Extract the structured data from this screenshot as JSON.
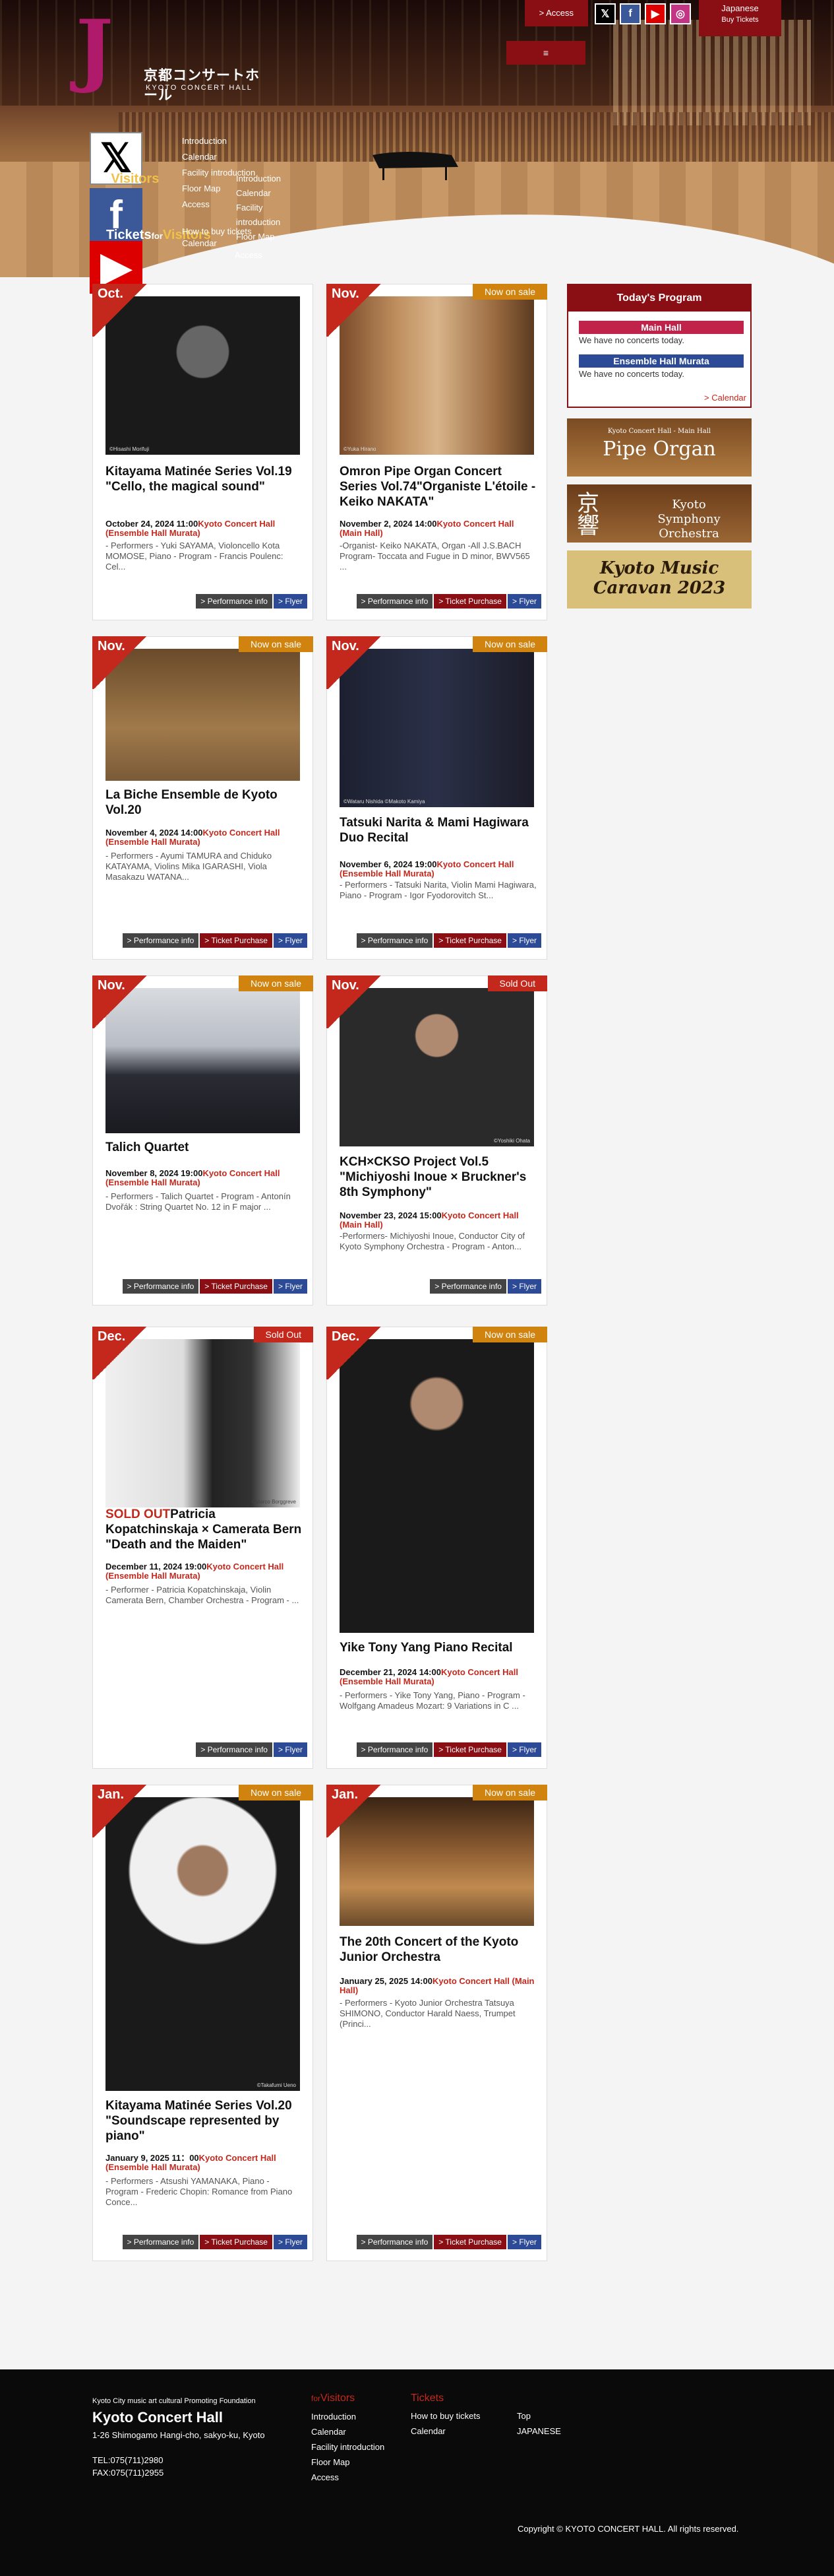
{
  "header": {
    "logo_jp": "京都コンサートホール",
    "logo_en": "KYOTO CONCERT HALL",
    "logo_mark": "J",
    "access_label": "> Access",
    "menu_label": "≡",
    "lang_label": "Japanese",
    "buy_tickets_label": "Buy Tickets",
    "sns": [
      "x-icon",
      "facebook-icon",
      "youtube-icon",
      "instagram-icon"
    ]
  },
  "nav": {
    "visitors_label": "Visitors",
    "for_label": "for",
    "tickets_label": "Tickets",
    "for_visitors_label": "Visitors",
    "links_col1": [
      "Introduction",
      "Calendar",
      "Facility introduction",
      "Floor Map",
      "Access"
    ],
    "links_col2": [
      "Introduction",
      "Calendar",
      "Facility introduction",
      "Floor Map"
    ],
    "tickets_links": [
      "How to buy tickets",
      "Calendar",
      "Access"
    ]
  },
  "cards": [
    {
      "month": "Oct.",
      "status": "",
      "credit": "©Hisashi Morifuji",
      "title": "Kitayama Matinée Series Vol.19 \"Cello, the magical sound\"",
      "date": "October 24, 2024 11:00",
      "venue": "Kyoto Concert Hall (Ensemble Hall Murata)",
      "desc": "- Performers - Yuki SAYAMA, Violoncello Kota MOMOSE, Piano - Program - Francis Poulenc: Cel...",
      "buttons": [
        "> Performance info",
        "> Flyer"
      ]
    },
    {
      "month": "Nov.",
      "status": "Now on sale",
      "credit": "©Yuka Hirano",
      "title": "Omron Pipe Organ Concert Series Vol.74\"Organiste L'étoile - Keiko NAKATA\"",
      "date": "November 2, 2024 14:00",
      "venue": "Kyoto Concert Hall (Main Hall)",
      "desc": "-Organist- Keiko NAKATA, Organ -All J.S.BACH Program- Toccata and Fugue in D minor, BWV565 ...",
      "buttons": [
        "> Performance info",
        "> Ticket Purchase",
        "> Flyer"
      ]
    },
    {
      "month": "Nov.",
      "status": "Now on sale",
      "credit": "",
      "title": "La Biche Ensemble de Kyoto Vol.20",
      "date": "November 4, 2024 14:00",
      "venue": "Kyoto Concert Hall (Ensemble Hall Murata)",
      "desc": "- Performers - Ayumi TAMURA and Chiduko KATAYAMA, Violins Mika IGARASHI, Viola Masakazu WATANA...",
      "buttons": [
        "> Performance info",
        "> Ticket Purchase",
        "> Flyer"
      ]
    },
    {
      "month": "Nov.",
      "status": "Now on sale",
      "credit": "©Wataru Nishida    ©Makoto Kamiya",
      "title": "Tatsuki Narita & Mami Hagiwara Duo Recital",
      "date": "November 6, 2024 19:00",
      "venue": "Kyoto Concert Hall (Ensemble Hall Murata)",
      "desc": "- Performers - Tatsuki Narita, Violin Mami Hagiwara, Piano - Program - Igor Fyodorovitch St...",
      "buttons": [
        "> Performance info",
        "> Ticket Purchase",
        "> Flyer"
      ]
    },
    {
      "month": "Nov.",
      "status": "Now on sale",
      "credit": "",
      "title": "Talich Quartet",
      "date": "November 8, 2024 19:00",
      "venue": "Kyoto Concert Hall (Ensemble Hall Murata)",
      "desc": "- Performers - Talich Quartet - Program - Antonín Dvořák : String Quartet No. 12 in F major ...",
      "buttons": [
        "> Performance info",
        "> Ticket Purchase",
        "> Flyer"
      ]
    },
    {
      "month": "Nov.",
      "status": "Sold Out",
      "credit": "©Yoshiki Ohata",
      "title": "KCH×CKSO Project Vol.5 \"Michiyoshi Inoue × Bruckner's 8th Symphony\"",
      "date": "November 23, 2024 15:00",
      "venue": "Kyoto Concert Hall (Main Hall)",
      "desc": "-Performers- Michiyoshi Inoue, Conductor City of Kyoto Symphony Orchestra - Program - Anton...",
      "buttons": [
        "> Performance info",
        "> Flyer"
      ]
    },
    {
      "month": "Dec.",
      "status": "Sold Out",
      "credit": "©Marco Borggreve",
      "title_prefix": "SOLD OUT",
      "title": "Patricia Kopatchinskaja × Camerata Bern \"Death and the Maiden\"",
      "date": "December 11, 2024 19:00",
      "venue": "Kyoto Concert Hall (Ensemble Hall Murata)",
      "desc": "- Performer - Patricia Kopatchinskaja, Violin Camerata Bern, Chamber Orchestra - Program - ...",
      "buttons": [
        "> Performance info",
        "> Flyer"
      ]
    },
    {
      "month": "Dec.",
      "status": "Now on sale",
      "credit": "",
      "title": "Yike Tony Yang Piano Recital",
      "date": "December 21, 2024 14:00",
      "venue": "Kyoto Concert Hall (Ensemble Hall Murata)",
      "desc": "- Performers - Yike Tony Yang, Piano - Program - Wolfgang Amadeus Mozart: 9 Variations in C ...",
      "buttons": [
        "> Performance info",
        "> Ticket Purchase",
        "> Flyer"
      ]
    },
    {
      "month": "Jan.",
      "status": "Now on sale",
      "credit": "©Takafumi Ueno",
      "title": "Kitayama Matinée Series Vol.20 \"Soundscape represented by piano\"",
      "date": "January 9, 2025 11：00",
      "venue": "Kyoto Concert Hall (Ensemble Hall Murata)",
      "desc": "- Performers - Atsushi YAMANAKA, Piano - Program - Frederic Chopin: Romance from Piano Conce...",
      "buttons": [
        "> Performance info",
        "> Ticket Purchase",
        "> Flyer"
      ]
    },
    {
      "month": "Jan.",
      "status": "Now on sale",
      "credit": "",
      "title": "The 20th Concert of the Kyoto Junior Orchestra",
      "date": "January 25, 2025 14:00",
      "venue": "Kyoto Concert Hall (Main Hall)",
      "desc": "- Performers - Kyoto Junior Orchestra Tatsuya SHIMONO, Conductor Harald Naess, Trumpet (Princi...",
      "buttons": [
        "> Performance info",
        "> Ticket Purchase",
        "> Flyer"
      ]
    }
  ],
  "sidebar": {
    "today_title": "Today's Program",
    "main_hall": "Main Hall",
    "murata_hall": "Ensemble Hall Murata",
    "no_concerts": "We have no concerts today.",
    "calendar_link": "> Calendar",
    "banner1_small": "Kyoto Concert Hall - Main Hall",
    "banner1_big": "Pipe Organ",
    "banner2_kanji": "京響",
    "banner2_text": "Kyoto Symphony Orchestra",
    "banner3_text": "Kyoto Music Caravan 2023"
  },
  "footer": {
    "org": "Kyoto City music art cultural Promoting Foundation",
    "name": "Kyoto Concert Hall",
    "address": "1-26 Shimogamo Hangi-cho, sakyo-ku, Kyoto",
    "tel": "TEL:075(711)2980",
    "fax": "FAX:075(711)2955",
    "visitors_head": "Visitors",
    "visitors_for": "for",
    "visitors_links": [
      "Introduction",
      "Calendar",
      "Facility introduction",
      "Floor Map",
      "Access"
    ],
    "tickets_head": "Tickets",
    "tickets_links": [
      "How to buy tickets",
      "Calendar"
    ],
    "other_links": [
      "Top",
      "JAPANESE"
    ],
    "copyright": "Copyright © KYOTO CONCERT HALL. All rights reserved."
  },
  "colors": {
    "brand": "#8a0f14",
    "accent_red": "#c4281c",
    "sale": "#d0830e",
    "flyer": "#2c4a96"
  }
}
